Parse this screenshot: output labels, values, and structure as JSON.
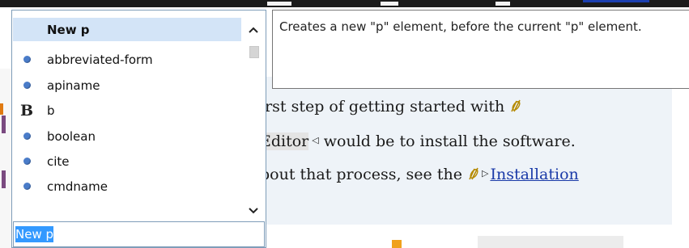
{
  "document": {
    "line1_text": "irst step of getting started with",
    "line2_prefix": "Editor",
    "line2_suffix": "would be to install the software.",
    "line3_prefix": "bout that process, see the",
    "line3_link": "Installation"
  },
  "completion_popup": {
    "items": [
      {
        "label": "New p",
        "icon": "none",
        "selected": true
      },
      {
        "label": "abbreviated-form",
        "icon": "element-dot-icon",
        "selected": false
      },
      {
        "label": "apiname",
        "icon": "element-dot-icon",
        "selected": false
      },
      {
        "label": "b",
        "icon": "bold-b-icon",
        "selected": false
      },
      {
        "label": "boolean",
        "icon": "element-dot-icon",
        "selected": false
      },
      {
        "label": "cite",
        "icon": "element-dot-icon",
        "selected": false
      },
      {
        "label": "cmdname",
        "icon": "element-dot-icon",
        "selected": false
      }
    ],
    "filter_value": "New p"
  },
  "tooltip": {
    "text": "Creates a new \"p\" element, before the current \"p\" element."
  },
  "colors": {
    "selection_highlight": "#d3e4f7",
    "element_dot": "#4a7cc9",
    "input_selection": "#3399ff",
    "link": "#1a3aa8",
    "doc_panel": "#eef3f8"
  }
}
